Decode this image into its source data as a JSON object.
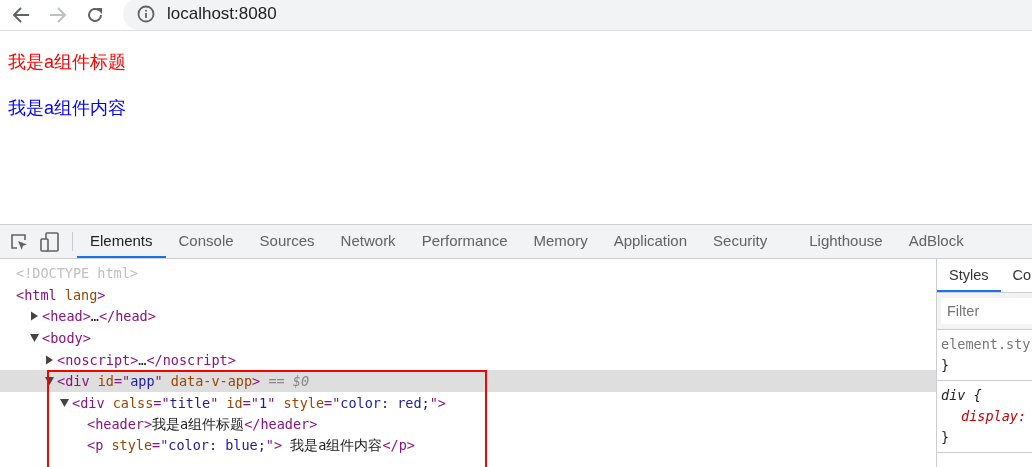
{
  "browser": {
    "url": "localhost:8080"
  },
  "page": {
    "lines": [
      {
        "text": "我是a组件标题",
        "color": "#ff0000"
      },
      {
        "text": "我是a组件内容",
        "color": "#0000ff"
      }
    ]
  },
  "devtools": {
    "tabs": [
      {
        "label": "Elements",
        "selected": true
      },
      {
        "label": "Console",
        "selected": false
      },
      {
        "label": "Sources",
        "selected": false
      },
      {
        "label": "Network",
        "selected": false
      },
      {
        "label": "Performance",
        "selected": false
      },
      {
        "label": "Memory",
        "selected": false
      },
      {
        "label": "Application",
        "selected": false
      },
      {
        "label": "Security",
        "selected": false
      },
      {
        "label": "Lighthouse",
        "selected": false
      },
      {
        "label": "AdBlock",
        "selected": false
      }
    ],
    "tree": [
      {
        "segments": [
          {
            "kind": "doctype",
            "text": "<!DOCTYPE html>"
          }
        ]
      },
      {
        "segments": [
          {
            "kind": "tag",
            "text": "<html "
          },
          {
            "kind": "attr",
            "text": "lang"
          },
          {
            "kind": "tag",
            "text": ">"
          }
        ],
        "children": [
          {
            "expanded": false,
            "segments": [
              {
                "kind": "tag",
                "text": "<head>"
              },
              {
                "kind": "text",
                "text": "…"
              },
              {
                "kind": "tag",
                "text": "</head>"
              }
            ]
          },
          {
            "expanded": true,
            "segments": [
              {
                "kind": "tag",
                "text": "<body>"
              }
            ],
            "children": [
              {
                "expanded": false,
                "segments": [
                  {
                    "kind": "tag",
                    "text": "<noscript>"
                  },
                  {
                    "kind": "text",
                    "text": "…"
                  },
                  {
                    "kind": "tag",
                    "text": "</noscript>"
                  }
                ]
              },
              {
                "expanded": true,
                "selected": true,
                "annotated": true,
                "segments": [
                  {
                    "kind": "tag",
                    "text": "<div "
                  },
                  {
                    "kind": "attr",
                    "text": "id"
                  },
                  {
                    "kind": "tag",
                    "text": "=\""
                  },
                  {
                    "kind": "value",
                    "text": "app"
                  },
                  {
                    "kind": "tag",
                    "text": "\" "
                  },
                  {
                    "kind": "attr",
                    "text": "data-v-app"
                  },
                  {
                    "kind": "tag",
                    "text": ">"
                  },
                  {
                    "kind": "ref",
                    "text": " == $0"
                  }
                ],
                "children": [
                  {
                    "expanded": true,
                    "segments": [
                      {
                        "kind": "tag",
                        "text": "<div "
                      },
                      {
                        "kind": "attr",
                        "text": "calss"
                      },
                      {
                        "kind": "tag",
                        "text": "=\""
                      },
                      {
                        "kind": "value",
                        "text": "title"
                      },
                      {
                        "kind": "tag",
                        "text": "\" "
                      },
                      {
                        "kind": "attr",
                        "text": "id"
                      },
                      {
                        "kind": "tag",
                        "text": "=\""
                      },
                      {
                        "kind": "value",
                        "text": "1"
                      },
                      {
                        "kind": "tag",
                        "text": "\" "
                      },
                      {
                        "kind": "attr",
                        "text": "style"
                      },
                      {
                        "kind": "tag",
                        "text": "=\""
                      },
                      {
                        "kind": "value",
                        "text": "color: red;"
                      },
                      {
                        "kind": "tag",
                        "text": "\">"
                      }
                    ],
                    "children": [
                      {
                        "segments": [
                          {
                            "kind": "tag",
                            "text": "<header>"
                          },
                          {
                            "kind": "text",
                            "text": "我是a组件标题"
                          },
                          {
                            "kind": "tag",
                            "text": "</header>"
                          }
                        ]
                      },
                      {
                        "segments": [
                          {
                            "kind": "tag",
                            "text": "<p "
                          },
                          {
                            "kind": "attr",
                            "text": "style"
                          },
                          {
                            "kind": "tag",
                            "text": "=\""
                          },
                          {
                            "kind": "value",
                            "text": "color: blue;"
                          },
                          {
                            "kind": "tag",
                            "text": "\">"
                          },
                          {
                            "kind": "text",
                            "text": " 我是a组件内容"
                          },
                          {
                            "kind": "tag",
                            "text": "</p>"
                          }
                        ]
                      }
                    ]
                  }
                ]
              }
            ]
          }
        ]
      }
    ],
    "side_tabs": [
      {
        "label": "Styles",
        "selected": true
      },
      {
        "label": "Co",
        "selected": false
      }
    ],
    "filter": {
      "placeholder": "Filter"
    },
    "rules": [
      {
        "lines": [
          {
            "kind": "selector-muted",
            "text": "element.sty"
          },
          {
            "kind": "brace",
            "text": "}"
          }
        ]
      },
      {
        "lines": [
          {
            "kind": "selector",
            "text": "div {"
          },
          {
            "kind": "property",
            "text": "display:"
          },
          {
            "kind": "brace",
            "text": "}"
          }
        ]
      }
    ]
  }
}
